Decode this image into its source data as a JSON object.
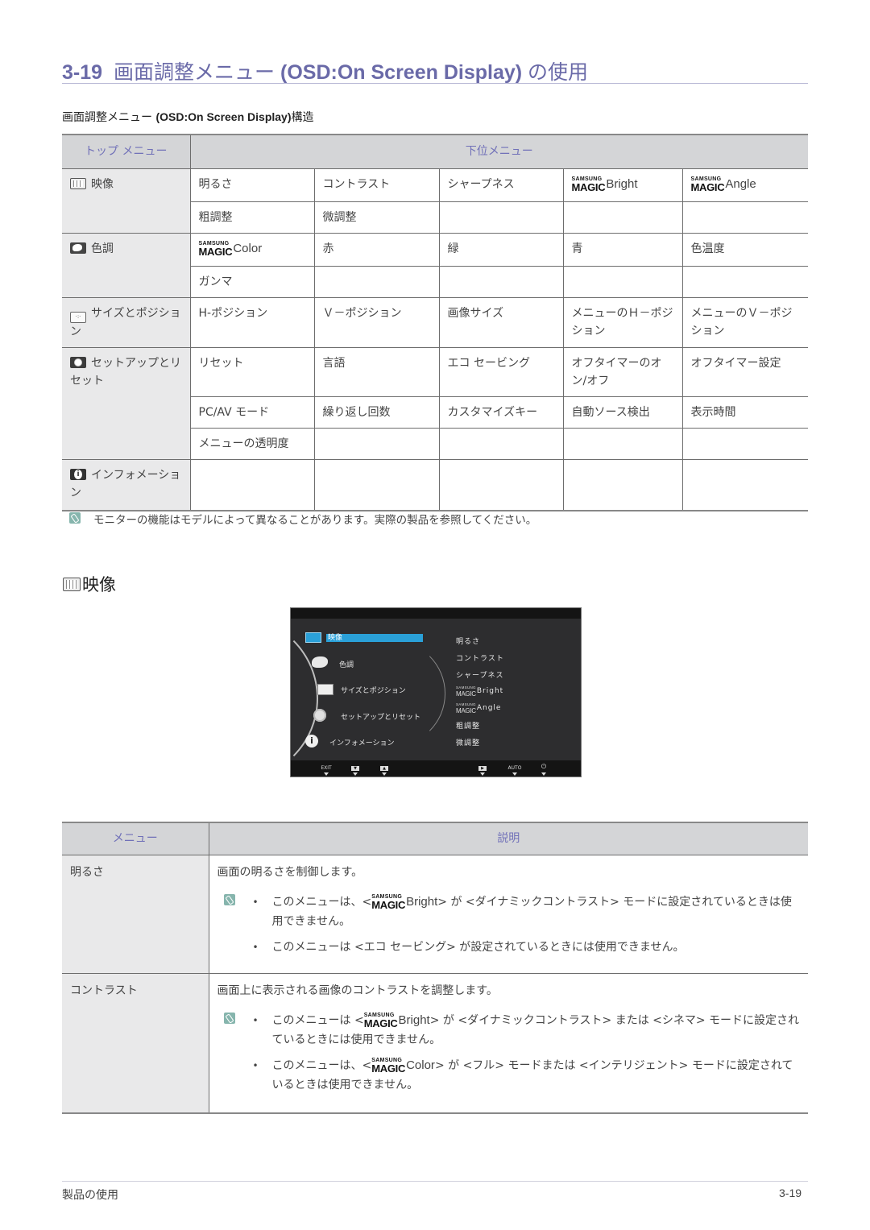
{
  "section": {
    "number": "3-19",
    "title_jp": "画面調整メニュー",
    "title_latin": "(OSD:On Screen Display)",
    "title_suffix": "の使用"
  },
  "structure_heading": {
    "prefix": "画面調整メニュー",
    "latin": "(OSD:On Screen Display)",
    "suffix": "構造"
  },
  "brand": {
    "samsung": "SAMSUNG",
    "magic": "MAGIC"
  },
  "menu_table": {
    "headers": {
      "top_menu": "トップ メニュー",
      "sub_menu": "下位メニュー"
    },
    "groups": [
      {
        "icon": "picture-icon",
        "label": "映像",
        "rows": [
          [
            "明るさ",
            "コントラスト",
            "シャープネス",
            "MAGIC:Bright",
            "MAGIC:Angle"
          ],
          [
            "粗調整",
            "微調整",
            "",
            "",
            ""
          ]
        ]
      },
      {
        "icon": "color-palette-icon",
        "label": "色調",
        "rows": [
          [
            "MAGIC:Color",
            "赤",
            "緑",
            "青",
            "色温度"
          ],
          [
            "ガンマ",
            "",
            "",
            "",
            ""
          ]
        ]
      },
      {
        "icon": "size-position-icon",
        "label": "サイズとポジション",
        "rows": [
          [
            "H-ポジション",
            "Ｖ－ポジション",
            "画像サイズ",
            "メニューのＨ－ポジション",
            "メニューのＶ－ポジション"
          ]
        ]
      },
      {
        "icon": "gear-icon",
        "label": "セットアップとリセット",
        "rows": [
          [
            "リセット",
            "言語",
            "エコ セービング",
            "オフタイマーのオン/オフ",
            "オフタイマー設定"
          ],
          [
            "PC/AV モード",
            "繰り返し回数",
            "カスタマイズキー",
            "自動ソース検出",
            "表示時間"
          ],
          [
            "メニューの透明度",
            "",
            "",
            "",
            ""
          ]
        ]
      },
      {
        "icon": "info-icon",
        "label": "インフォメーション",
        "rows": [
          [
            "",
            "",
            "",
            "",
            ""
          ]
        ]
      }
    ],
    "magic_labels": {
      "bright": "Bright",
      "angle": "Angle",
      "color": "Color"
    }
  },
  "note_model": "モニターの機能はモデルによって異なることがあります。実際の製品を参照してください。",
  "picture_heading": "映像",
  "osd_screen": {
    "top_items": [
      "映像",
      "色調",
      "サイズとポジション",
      "セットアップとリセット",
      "インフォメーション"
    ],
    "selected_index": 0,
    "sub_items": [
      "明るさ",
      "コントラスト",
      "シャープネス",
      "MAGIC:Bright",
      "MAGIC:Angle",
      "粗調整",
      "微調整"
    ],
    "buttons": [
      "EXIT",
      "▼",
      "▲",
      "▶",
      "AUTO",
      "⏻"
    ]
  },
  "desc_table": {
    "headers": {
      "menu": "メニュー",
      "description": "説明"
    },
    "rows": [
      {
        "menu": "明るさ",
        "description": "画面の明るさを制御します。",
        "notes": [
          {
            "before": "このメニューは、<",
            "magic": "Bright",
            "after": "> が <ダイナミックコントラスト> モードに設定されているときは使用できません。"
          },
          {
            "before": "このメニューは <エコ セービング> が設定されているときには使用できません。",
            "magic": "",
            "after": ""
          }
        ]
      },
      {
        "menu": "コントラスト",
        "description": "画面上に表示される画像のコントラストを調整します。",
        "notes": [
          {
            "before": "このメニューは <",
            "magic": "Bright",
            "after": "> が <ダイナミックコントラスト> または <シネマ> モードに設定されているときには使用できません。"
          },
          {
            "before": "このメニューは、<",
            "magic": "Color",
            "after": "> が <フル> モードまたは <インテリジェント> モードに設定されているときは使用できません。"
          }
        ]
      }
    ]
  },
  "footer": {
    "left": "製品の使用",
    "right": "3-19"
  }
}
